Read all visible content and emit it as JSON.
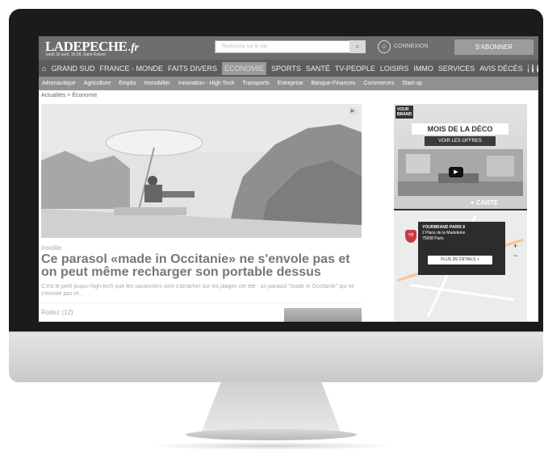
{
  "site": {
    "logo": "LADEPECHE",
    "logo_suffix": ".fr",
    "date_line": "lundi 30 avril, 16:28, Saint Robert",
    "search_placeholder": "Recherche sur le site",
    "connexion": "CONNEXION",
    "subscribe": "S'ABONNER"
  },
  "mainnav": [
    "GRAND SUD",
    "FRANCE - MONDE",
    "FAITS DIVERS",
    "ÉCONOMIE",
    "SPORTS",
    "SANTÉ",
    "TV-PEOPLE",
    "LOISIRS",
    "IMMO",
    "SERVICES",
    "AVIS DÉCÈS"
  ],
  "subnav": [
    "Aéronautique",
    "Agriculture",
    "Emploi",
    "Immobilier",
    "Innovation - High Tech",
    "Transports",
    "Entreprise",
    "Banque-Finances",
    "Commerces",
    "Start-up"
  ],
  "breadcrumb": "Actualités  >  Économie",
  "article": {
    "tag": "Insolite",
    "headline": "Ce parasol «made in Occitanie» ne s'envole pas et on peut même recharger son portable dessus",
    "description": "C'est le petit joujou high-tech que les vacanciers vont s'arracher sur les plages cet été : un parasol \"made in Occitanie\" qui ne s'envole pas et...",
    "next_location": "Rodez (12)"
  },
  "ad": {
    "brand_line1": "VOUR",
    "brand_line2": "BRAND",
    "title": "MOIS DE LA DÉCO",
    "cta": "VOIR LES OFFRES",
    "map_label": "CARTE",
    "store_name": "YOURBRAND PARIS 8",
    "store_addr1": "2 Place de la Madeleine",
    "store_addr2": "75008 Paris",
    "details_btn": "PLUS DE DÉTAILS >",
    "pin_label": "YB"
  },
  "colors": {
    "bezel": "#1b1b1b",
    "nav": "#5d5d5d",
    "pin": "#c73a47"
  }
}
